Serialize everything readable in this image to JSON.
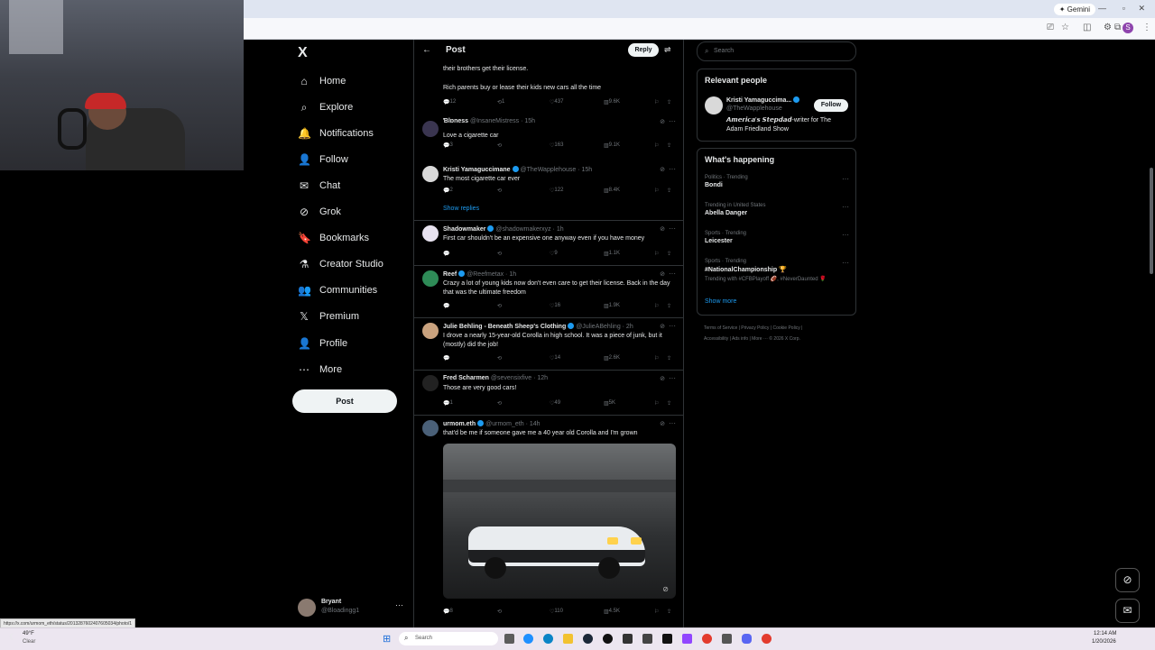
{
  "browser": {
    "gemini_label": "Gemini",
    "status_url": "https://x.com/urmom_eth/status/2013287602407605034/photo/1"
  },
  "nav": {
    "logo": "X",
    "items": [
      {
        "label": "Home",
        "icon": "home-icon",
        "glyph": "⌂"
      },
      {
        "label": "Explore",
        "icon": "search-icon",
        "glyph": "⌕"
      },
      {
        "label": "Notifications",
        "icon": "bell-icon",
        "glyph": "🔔"
      },
      {
        "label": "Follow",
        "icon": "person-plus-icon",
        "glyph": "👤"
      },
      {
        "label": "Chat",
        "icon": "mail-icon",
        "glyph": "✉"
      },
      {
        "label": "Grok",
        "icon": "grok-icon",
        "glyph": "⊘"
      },
      {
        "label": "Bookmarks",
        "icon": "bookmark-icon",
        "glyph": "🔖"
      },
      {
        "label": "Creator Studio",
        "icon": "flask-icon",
        "glyph": "⚗"
      },
      {
        "label": "Communities",
        "icon": "people-icon",
        "glyph": "👥"
      },
      {
        "label": "Premium",
        "icon": "x-premium-icon",
        "glyph": "𝕏"
      },
      {
        "label": "Profile",
        "icon": "profile-icon",
        "glyph": "👤"
      },
      {
        "label": "More",
        "icon": "more-circle-icon",
        "glyph": "⋯"
      }
    ],
    "post_label": "Post",
    "user": {
      "name": "Bryant",
      "handle": "@Bloadingg1"
    }
  },
  "header": {
    "back": "←",
    "title": "Post",
    "reply_label": "Reply"
  },
  "top_text": "Rich parents buy or lease their kids new cars all the time",
  "top_text_cut": "their brothers get their license.",
  "top_actions": {
    "reply": "12",
    "repost": "1",
    "like": "437",
    "views": "9.6K"
  },
  "tweets": [
    {
      "name": "Ɓlɒness",
      "handle": "@InsaneMistress · 15h",
      "text": "Love a cigarette car",
      "reply": "3",
      "repost": "",
      "like": "163",
      "views": "9.1K",
      "verified": false,
      "avatar_color": "#3a3550"
    },
    {
      "name": "Kristi Yamaguccimane",
      "handle": "@TheWapplehouse · 15h",
      "text": "The most cigarette car ever",
      "reply": "2",
      "repost": "",
      "like": "122",
      "views": "8.4K",
      "verified": true,
      "avatar_color": "#d9d9d9",
      "show_replies": "Show replies"
    },
    {
      "name": "Shadowmaker",
      "handle": "@shadowmakerxyz · 1h",
      "text": "First car shouldn't be an expensive one anyway even if you have money",
      "reply": "",
      "repost": "",
      "like": "9",
      "views": "1.1K",
      "verified": true,
      "avatar_color": "#e8e3f0"
    },
    {
      "name": "Reef",
      "handle": "@Reefmetax · 1h",
      "text": "Crazy a lot of young kids now don't even care to get their license. Back in the day that was the ultimate freedom",
      "reply": "",
      "repost": "",
      "like": "16",
      "views": "1.9K",
      "verified": true,
      "avatar_color": "#2e8b57"
    },
    {
      "name": "Julie Behling - Beneath Sheep's Clothing",
      "handle": "@JulieABehling · 2h",
      "text": "I drove a nearly 15-year-old Corolla in high school.  It was a piece of junk, but it (mostly) did the job!",
      "reply": "",
      "repost": "",
      "like": "14",
      "views": "2.6K",
      "verified": true,
      "avatar_color": "#c9a27e"
    },
    {
      "name": "Fred Scharmen",
      "handle": "@sevensixfive · 12h",
      "text": "Those are very good cars!",
      "reply": "1",
      "repost": "",
      "like": "49",
      "views": "5K",
      "verified": false,
      "avatar_color": "#222"
    },
    {
      "name": "urmom.eth",
      "handle": "@urmom_eth · 14h",
      "text": "that'd be me if someone gave me a 40 year old Corolla and I'm grown",
      "reply": "8",
      "repost": "",
      "like": "110",
      "views": "4.5K",
      "verified": true,
      "avatar_color": "#4a6078"
    }
  ],
  "right": {
    "search_placeholder": "Search",
    "relevant_title": "Relevant people",
    "person": {
      "name": "Kristi Yamaguccima...",
      "handle": "@TheWapplehouse",
      "bio": "𝘼𝙢𝙚𝙧𝙞𝙘𝙖'𝙨 𝙎𝙩𝙚𝙥𝙙𝙖𝙙-writer for The Adam Friedland Show",
      "follow_label": "Follow"
    },
    "happening_title": "What's happening",
    "trends": [
      {
        "cat": "Politics · Trending",
        "title": "Bondi"
      },
      {
        "cat": "Trending in United States",
        "title": "Abella Danger"
      },
      {
        "cat": "Sports · Trending",
        "title": "Leicester"
      },
      {
        "cat": "Sports · Trending",
        "title": "#NationalChampionship 🏆",
        "extra": "Trending with #CFBPlayoff 🏈, #NeverDaunted 🌹"
      }
    ],
    "show_more": "Show more",
    "footer_line1": "Terms of Service  |  Privacy Policy  |  Cookie Policy  |",
    "footer_line2": "Accessibility  |  Ads info  |  More ···  © 2026 X Corp."
  },
  "taskbar": {
    "weather_temp": "49°F",
    "weather_cond": "Clear",
    "search_placeholder": "Search",
    "time": "12:14 AM",
    "date": "1/20/2026"
  }
}
